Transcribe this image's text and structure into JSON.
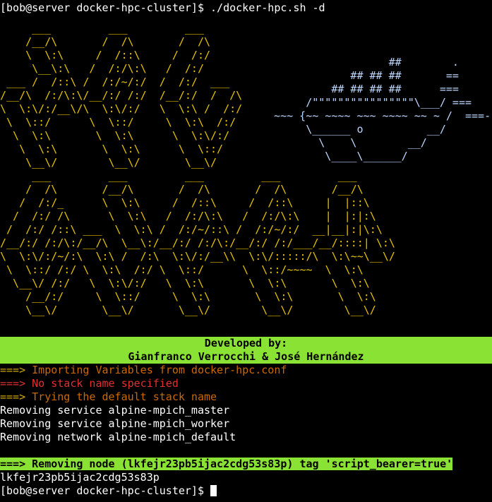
{
  "prompt": {
    "first": "[bob@server docker-hpc-cluster]$ ",
    "command": "./docker-hpc.sh -d",
    "last": "[bob@server docker-hpc-cluster]$ "
  },
  "banner": {
    "ascii_art": "     ___         ___         ___\n    /__/\\       /  /\\       /  /\\\n    \\  \\:\\     /  /::\\     /  /:/\n     \\__\\:\\   /  /:/\\:\\   /  /:/\n ___ /  /::\\ /  /:/~/:/  /  /:/  ___\n/__/\\  /:/\\:\\/__/:/ /:/  /__/:/  /  /\\\n\\  \\:\\/:/__\\/\\  \\:\\/:/   \\  \\:\\ /  /:/\n \\  \\::/      \\  \\::/     \\  \\:\\  /:/\n  \\  \\:\\       \\  \\:\\      \\  \\:\\/:/\n   \\  \\:\\       \\  \\:\\      \\  \\::/\n    \\__\\/        \\__\\/       \\__\\/\n     ___         ___         ___         ___         ___\n    /  /\\       /__/\\       /  /\\       /  /\\       /__/\\\n   /  /:/_      \\  \\:\\     /  /::\\     /  /::\\     |  |::\\\n  /  /:/ /\\      \\  \\:\\   /  /:/\\:\\   /  /:/\\:\\    |  |:|:\\\n /  /:/ /::\\ ___  \\  \\:\\ /  /:/~/::\\ /  /:/~/:/  __|__|:|\\:\\\n/__/:/ /:/\\:/__/\\  \\__\\:/__/:/ /:/\\:/__/:/ /:/___/__/::::| \\:\\\n\\  \\:\\/:/~/:\\  \\:\\ /  /:\\  \\:\\/:/__\\\\  \\:\\/:::::/\\  \\:\\~~\\__\\/\n \\  \\::/ /:/ \\  \\:\\  /:/ \\  \\::/      \\  \\::/~~~~  \\  \\:\\\n  \\__\\/ /:/   \\  \\:\\/:/   \\  \\:\\       \\  \\:\\       \\  \\:\\\n    /__/:/     \\  \\::/     \\  \\:\\       \\  \\:\\       \\  \\:\\\n    \\__\\/       \\__\\/       \\__\\/        \\__\\/        \\__\\/",
    "whale_art": "                    ##        .\n              ## ## ##       ==\n           ## ## ## ##      ===\n       /\"\"\"\"\"\"\"\"\"\"\"\"\"\"\"\"\\___/ ===\n  ~~~ {~~ ~~~~ ~~~ ~~~~ ~~ ~ /  ===- ~\n       \\______ o          __/\n         \\    \\        __/\n          \\____\\______/"
  },
  "credits": {
    "line1": "Developed by:",
    "line2": "Gianfranco Verrocchi & José Hernández"
  },
  "output": [
    {
      "arrow": "===> ",
      "text": "Importing Variables from docker-hpc.conf",
      "kind": "info"
    },
    {
      "arrow": "===> ",
      "text": "No stack name specified",
      "kind": "error"
    },
    {
      "arrow": "===> ",
      "text": "Trying the default stack name",
      "kind": "info"
    },
    {
      "arrow": "",
      "text": "Removing service alpine-mpich_master",
      "kind": "plain"
    },
    {
      "arrow": "",
      "text": "Removing service alpine-mpich_worker",
      "kind": "plain"
    },
    {
      "arrow": "",
      "text": "Removing network alpine-mpich_default",
      "kind": "plain"
    }
  ],
  "node_line": "===> Removing node (lkfejr23pb5ijac2cdg53s83p) tag 'script_bearer=true'",
  "node_id": "lkfejr23pb5ijac2cdg53s83p",
  "colors": {
    "ascii": "#e5c300",
    "whale": "#bdd7ff",
    "highlight": "#8ae234",
    "error": "#e0302f",
    "arrow": "#d4a800"
  }
}
